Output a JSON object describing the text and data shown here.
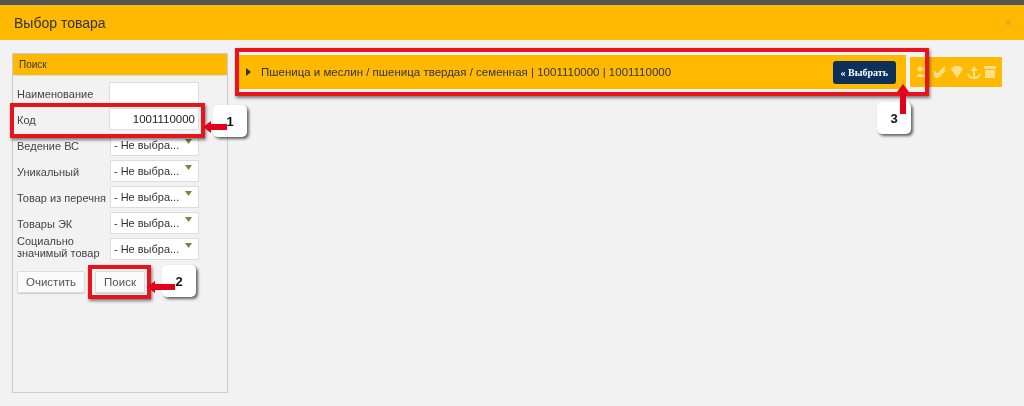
{
  "window": {
    "title": "Выбор товара",
    "close": "×"
  },
  "search_panel": {
    "title": "Поиск",
    "fields": [
      {
        "label": "Наименование",
        "kind": "text"
      },
      {
        "label": "Код",
        "kind": "text",
        "value": "1001110000"
      },
      {
        "label": "Ведение ВС",
        "kind": "select",
        "value": "- Не выбра..."
      },
      {
        "label": "Уникальный",
        "kind": "select",
        "value": "- Не выбра..."
      },
      {
        "label": "Товар из перечня",
        "kind": "select",
        "value": "- Не выбра..."
      },
      {
        "label": "Товары ЭК",
        "kind": "select",
        "value": "- Не выбра..."
      },
      {
        "label": "Социально значимый товар",
        "kind": "select",
        "value": "- Не выбра..."
      }
    ],
    "buttons": [
      "Очистить",
      "Поиск"
    ]
  },
  "results": [
    {
      "text": "Пшеница и меслин / пшеница твердая / семенная | 1001110000 | 1001110000",
      "button": "« Выбрать",
      "expanded": false
    }
  ],
  "annotations": [
    {
      "number": "1"
    },
    {
      "number": "2"
    },
    {
      "number": "3"
    }
  ]
}
